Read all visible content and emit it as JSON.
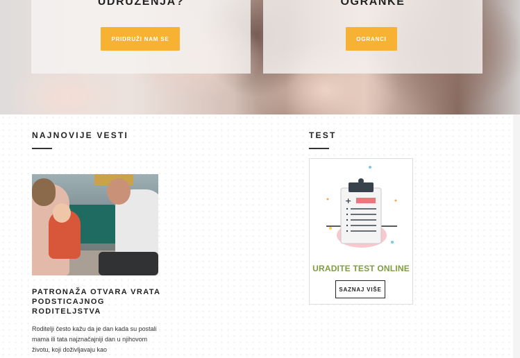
{
  "hero": {
    "left_card": {
      "title": "UDRUŽENJA?",
      "button": "PRIDRUŽI NAM SE"
    },
    "right_card": {
      "title": "OGRANKE",
      "button": "OGRANCI"
    },
    "accent_color": "#f7b233"
  },
  "news": {
    "section_title": "NAJNOVIJE VESTI",
    "image_alt": "Roditelji sa detetom",
    "article_title": "PATRONAŽA OTVARA VRATA PODSTICAJNOG RODITELJSTVA",
    "article_excerpt": "Roditelji često kažu da je dan kada su postali mama ili tata najznačajniji dan u njihovom životu, koji doživljavaju kao"
  },
  "test": {
    "section_title": "TEST",
    "cta_text": "URADITE TEST ONLINE",
    "cta_color": "#7e9e3f",
    "button": "SAZNAJ VIŠE",
    "icon": "clipboard-checklist-icon"
  }
}
